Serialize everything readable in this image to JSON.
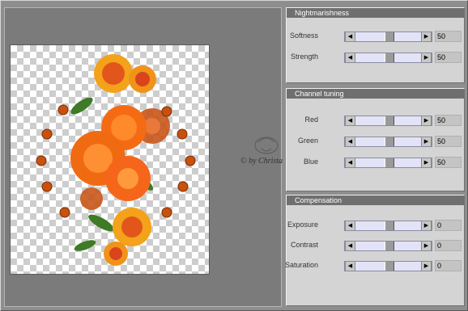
{
  "panels": [
    {
      "title": "Nightmarishness",
      "rows": [
        {
          "label": "Softness",
          "value": "50",
          "level": 0.5
        },
        {
          "label": "Strength",
          "value": "50",
          "level": 0.5
        }
      ]
    },
    {
      "title": "Channel tuning",
      "rows": [
        {
          "label": "Red",
          "value": "50",
          "level": 0.5
        },
        {
          "label": "Green",
          "value": "50",
          "level": 0.5
        },
        {
          "label": "Blue",
          "value": "50",
          "level": 0.5
        }
      ]
    },
    {
      "title": "Compensation",
      "rows": [
        {
          "label": "Exposure",
          "value": "0",
          "level": 0.5
        },
        {
          "label": "Contrast",
          "value": "0",
          "level": 0.5
        },
        {
          "label": "Saturation",
          "value": "0",
          "level": 0.5
        }
      ]
    }
  ],
  "icons": {
    "left": "left-arrow-icon",
    "right": "right-arrow-icon"
  },
  "watermark": {
    "text": "© by Christa"
  },
  "colors": {
    "flower": "#f06a12",
    "bead": "#c8510e",
    "leaf": "#3f7a26"
  }
}
